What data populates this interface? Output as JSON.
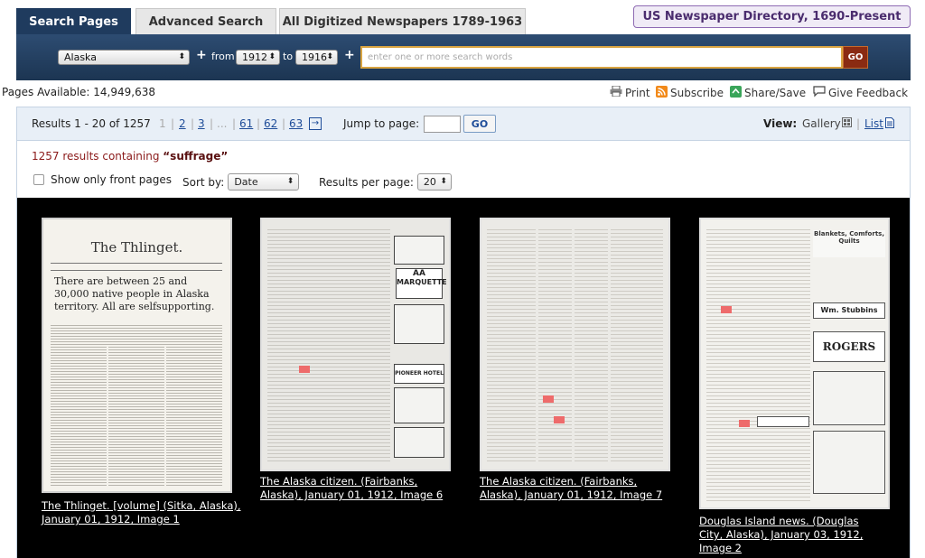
{
  "tabs": [
    {
      "label": "Search Pages",
      "active": true
    },
    {
      "label": "Advanced Search",
      "active": false
    },
    {
      "label": "All Digitized Newspapers 1789-1963",
      "active": false
    }
  ],
  "directory_link": "US Newspaper Directory, 1690-Present",
  "search": {
    "state": "Alaska",
    "plus": "+",
    "from_label": "from",
    "from_year": "1912",
    "to_label": "to",
    "to_year": "1916",
    "placeholder": "enter one or more search words",
    "go": "GO"
  },
  "pages_available": "Pages Available: 14,949,638",
  "tools": {
    "print": "Print",
    "subscribe": "Subscribe",
    "share": "Share/Save",
    "feedback": "Give Feedback"
  },
  "pager": {
    "results": "Results 1 - 20 of 1257",
    "current": "1",
    "p2": "2",
    "p3": "3",
    "ellipsis": "...",
    "p61": "61",
    "p62": "62",
    "p63": "63",
    "next": "→",
    "jump_label": "Jump to page:",
    "go": "GO",
    "view_label": "View:",
    "gallery": "Gallery",
    "list": "List"
  },
  "summary": {
    "prefix": "1257 results containing ",
    "term": "“suffrage”"
  },
  "filters": {
    "front_pages": "Show only front pages",
    "sort_label": "Sort by:",
    "sort_value": "Date",
    "per_page_label": "Results per page:",
    "per_page_value": "20"
  },
  "results": [
    {
      "caption": "The Thlinget. [volume] (Sitka, Alaska), January 01, 1912, Image 1",
      "masthead": "The Thlinget.",
      "headline": "There are between 25 and 30,000 native people in Alaska territory. All are selfsupporting."
    },
    {
      "caption": "The Alaska citizen. (Fairbanks, Alaska), January 01, 1912, Image 6",
      "ad1": "AA",
      "ad2": "MARQUETTE",
      "ad3": "PIONEER HOTEL"
    },
    {
      "caption": "The Alaska citizen. (Fairbanks, Alaska), January 01, 1912, Image 7"
    },
    {
      "caption": "Douglas Island news. (Douglas City, Alaska), January 03, 1912, Image 2",
      "ad1": "Blankets, Comforts, Quilts",
      "ad2": "Wm. Stubbins",
      "ad3": "ROGERS"
    }
  ]
}
